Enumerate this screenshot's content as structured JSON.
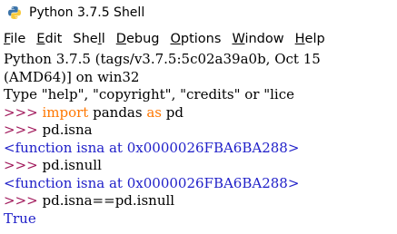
{
  "window": {
    "title": "Python 3.7.5 Shell"
  },
  "menu": [
    {
      "label": "File",
      "mnemonic": "F",
      "rest": "ile"
    },
    {
      "label": "Edit",
      "mnemonic": "E",
      "rest": "dit"
    },
    {
      "label": "Shell",
      "pre": "She",
      "mnemonic": "l",
      "rest": "l"
    },
    {
      "label": "Debug",
      "mnemonic": "D",
      "rest": "ebug"
    },
    {
      "label": "Options",
      "mnemonic": "O",
      "rest": "ptions"
    },
    {
      "label": "Window",
      "mnemonic": "W",
      "rest": "indow"
    },
    {
      "label": "Help",
      "mnemonic": "H",
      "rest": "elp"
    }
  ],
  "shell": {
    "banner": [
      "Python 3.7.5 (tags/v3.7.5:5c02a39a0b, Oct 15",
      "(AMD64)] on win32",
      "Type \"help\", \"copyright\", \"credits\" or \"lice"
    ],
    "prompt": ">>> ",
    "session": [
      {
        "kind": "input",
        "parts": [
          {
            "kw": "import"
          },
          {
            "t": " pandas "
          },
          {
            "kw": "as"
          },
          {
            "t": " pd"
          }
        ]
      },
      {
        "kind": "input",
        "text": "pd.isna"
      },
      {
        "kind": "output",
        "text": "<function isna at 0x0000026FBA6BA288>"
      },
      {
        "kind": "input",
        "text": "pd.isnull"
      },
      {
        "kind": "output",
        "text": "<function isna at 0x0000026FBA6BA288>"
      },
      {
        "kind": "input",
        "text": "pd.isna==pd.isnull"
      },
      {
        "kind": "output",
        "text": "True"
      }
    ]
  },
  "colors": {
    "prompt": "#a0175a",
    "keyword": "#ff7700",
    "output": "#1e1ec8",
    "text": "#000000",
    "background": "#ffffff"
  },
  "icons": {
    "app": "python-logo-icon"
  }
}
